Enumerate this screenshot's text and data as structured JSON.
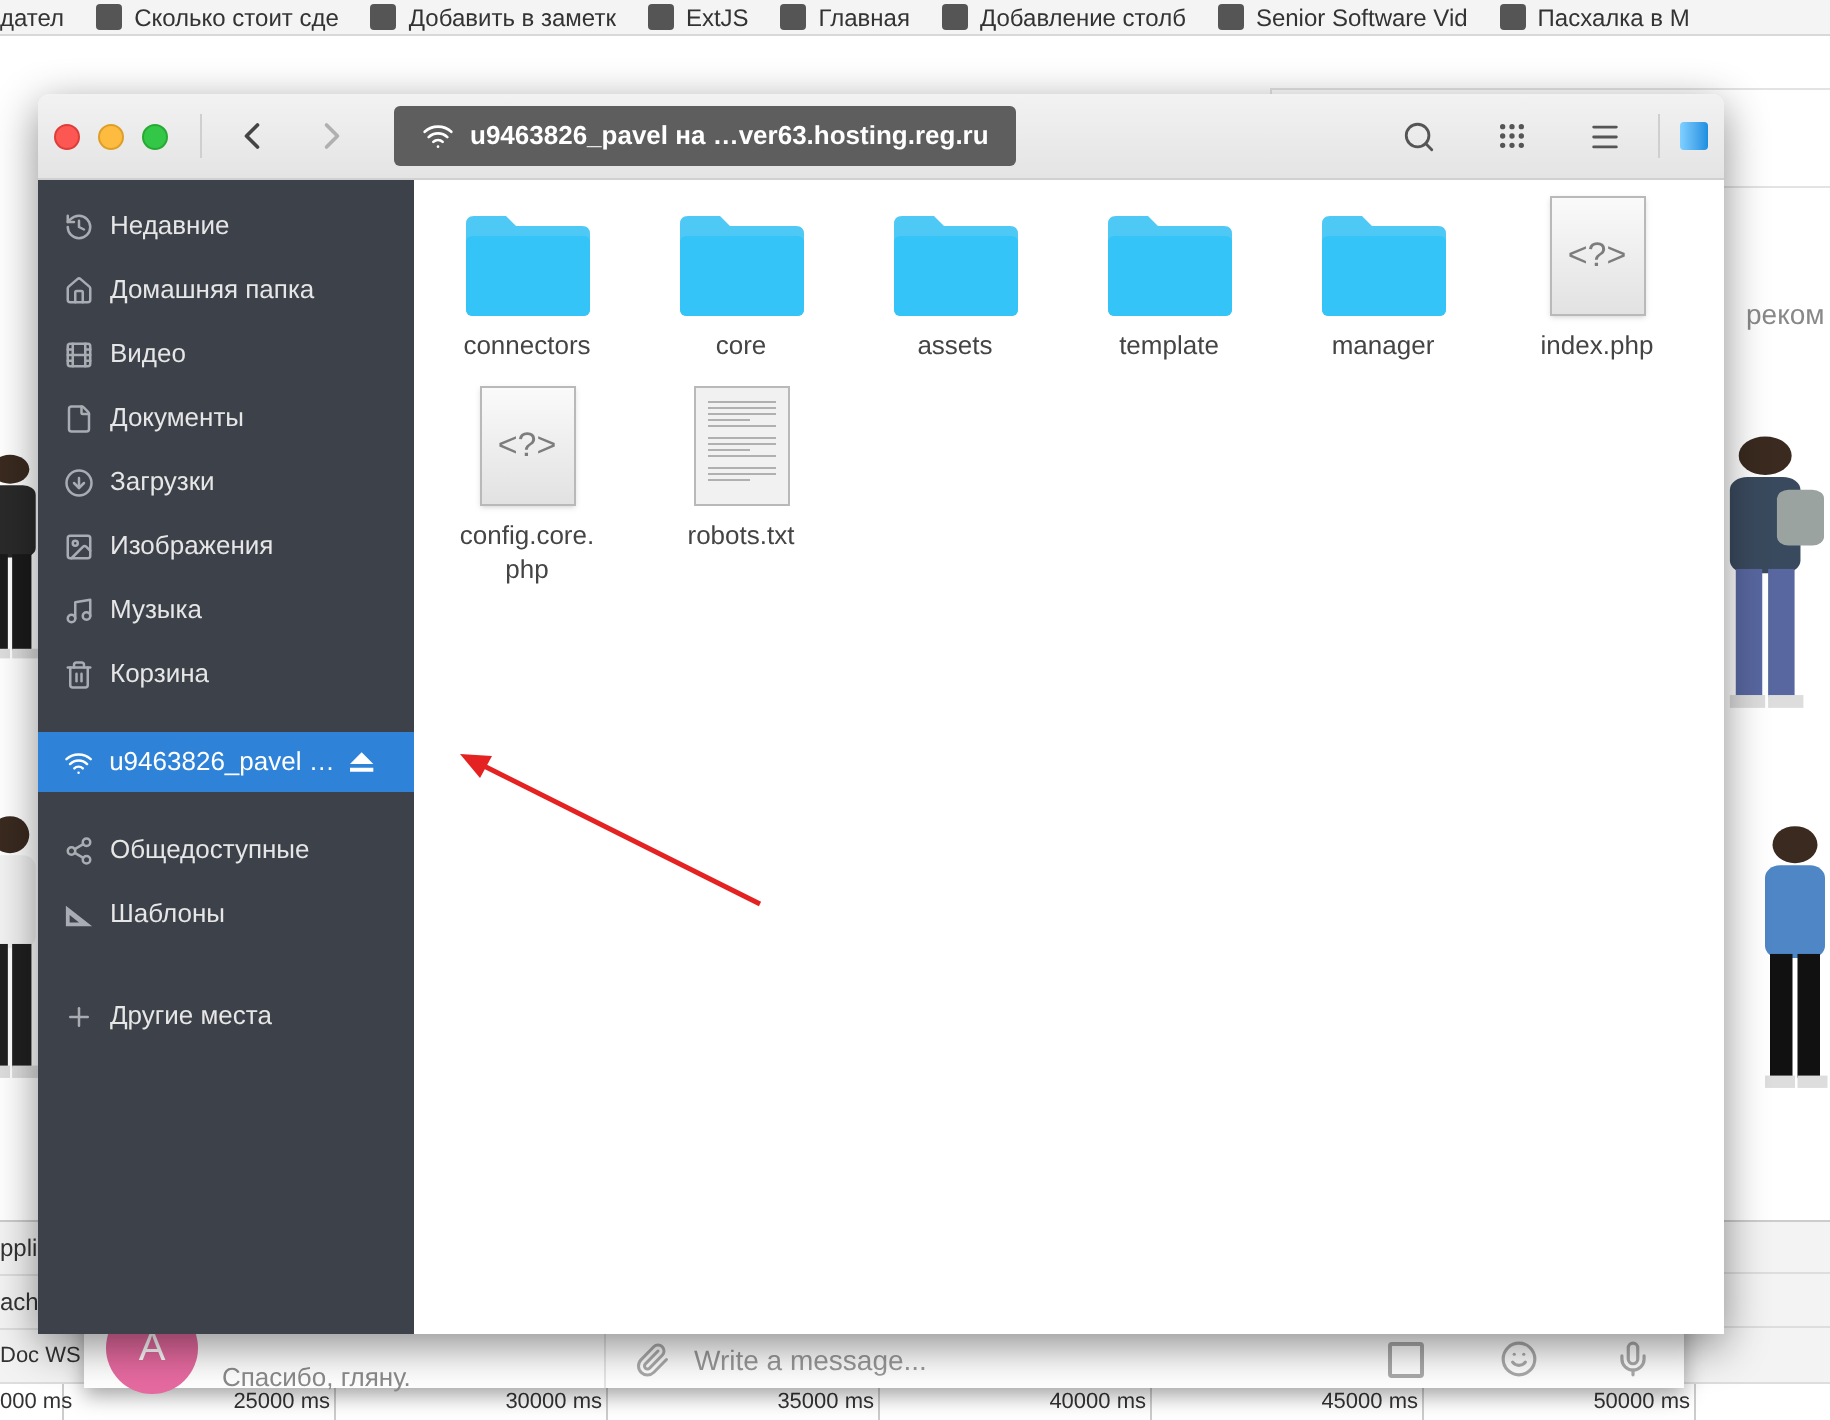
{
  "bookmarks": [
    {
      "label": "дател"
    },
    {
      "label": "Сколько стоит сде"
    },
    {
      "label": "Добавить в заметк"
    },
    {
      "label": "ExtJS"
    },
    {
      "label": "Главная"
    },
    {
      "label": "Добавление столб"
    },
    {
      "label": "Senior Software Vid"
    },
    {
      "label": "Пасхалка в М"
    }
  ],
  "background_page": {
    "side_text": "реком"
  },
  "devtools": {
    "tabs": [
      "ppli",
      "ach"
    ],
    "filters": [
      "Doc",
      "WS"
    ],
    "ticks": [
      "000 ms",
      "25000 ms",
      "30000 ms",
      "35000 ms",
      "40000 ms",
      "45000 ms",
      "50000 ms"
    ]
  },
  "chat": {
    "avatar_letter": "A",
    "preview": "Спасибо, гляну.",
    "composer": {
      "placeholder": "Write a message..."
    }
  },
  "window": {
    "title": "u9463826_pavel на …ver63.hosting.reg.ru",
    "back_enabled": true,
    "forward_enabled": false
  },
  "sidebar": {
    "sections": [
      {
        "items": [
          {
            "label": "Недавние",
            "selected": false,
            "ejectable": false
          },
          {
            "label": "Домашняя папка",
            "selected": false,
            "ejectable": false
          },
          {
            "label": "Видео",
            "selected": false,
            "ejectable": false
          },
          {
            "label": "Документы",
            "selected": false,
            "ejectable": false
          },
          {
            "label": "Загрузки",
            "selected": false,
            "ejectable": false
          },
          {
            "label": "Изображения",
            "selected": false,
            "ejectable": false
          },
          {
            "label": "Музыка",
            "selected": false,
            "ejectable": false
          },
          {
            "label": "Корзина",
            "selected": false,
            "ejectable": false
          }
        ]
      },
      {
        "items": [
          {
            "label": "u9463826_pavel …",
            "selected": true,
            "ejectable": true
          }
        ]
      },
      {
        "items": [
          {
            "label": "Общедоступные",
            "selected": false,
            "ejectable": false
          },
          {
            "label": "Шаблоны",
            "selected": false,
            "ejectable": false
          }
        ]
      },
      {
        "items": [
          {
            "label": "Другие места",
            "selected": false,
            "ejectable": false
          }
        ]
      }
    ]
  },
  "files": [
    {
      "name": "connectors",
      "kind": "folder"
    },
    {
      "name": "core",
      "kind": "folder"
    },
    {
      "name": "assets",
      "kind": "folder"
    },
    {
      "name": "template",
      "kind": "folder"
    },
    {
      "name": "manager",
      "kind": "folder"
    },
    {
      "name": "index.php",
      "kind": "script",
      "glyph": "<?>"
    },
    {
      "name": "config.core.php",
      "kind": "script",
      "glyph": "<?>"
    },
    {
      "name": "robots.txt",
      "kind": "text"
    }
  ]
}
